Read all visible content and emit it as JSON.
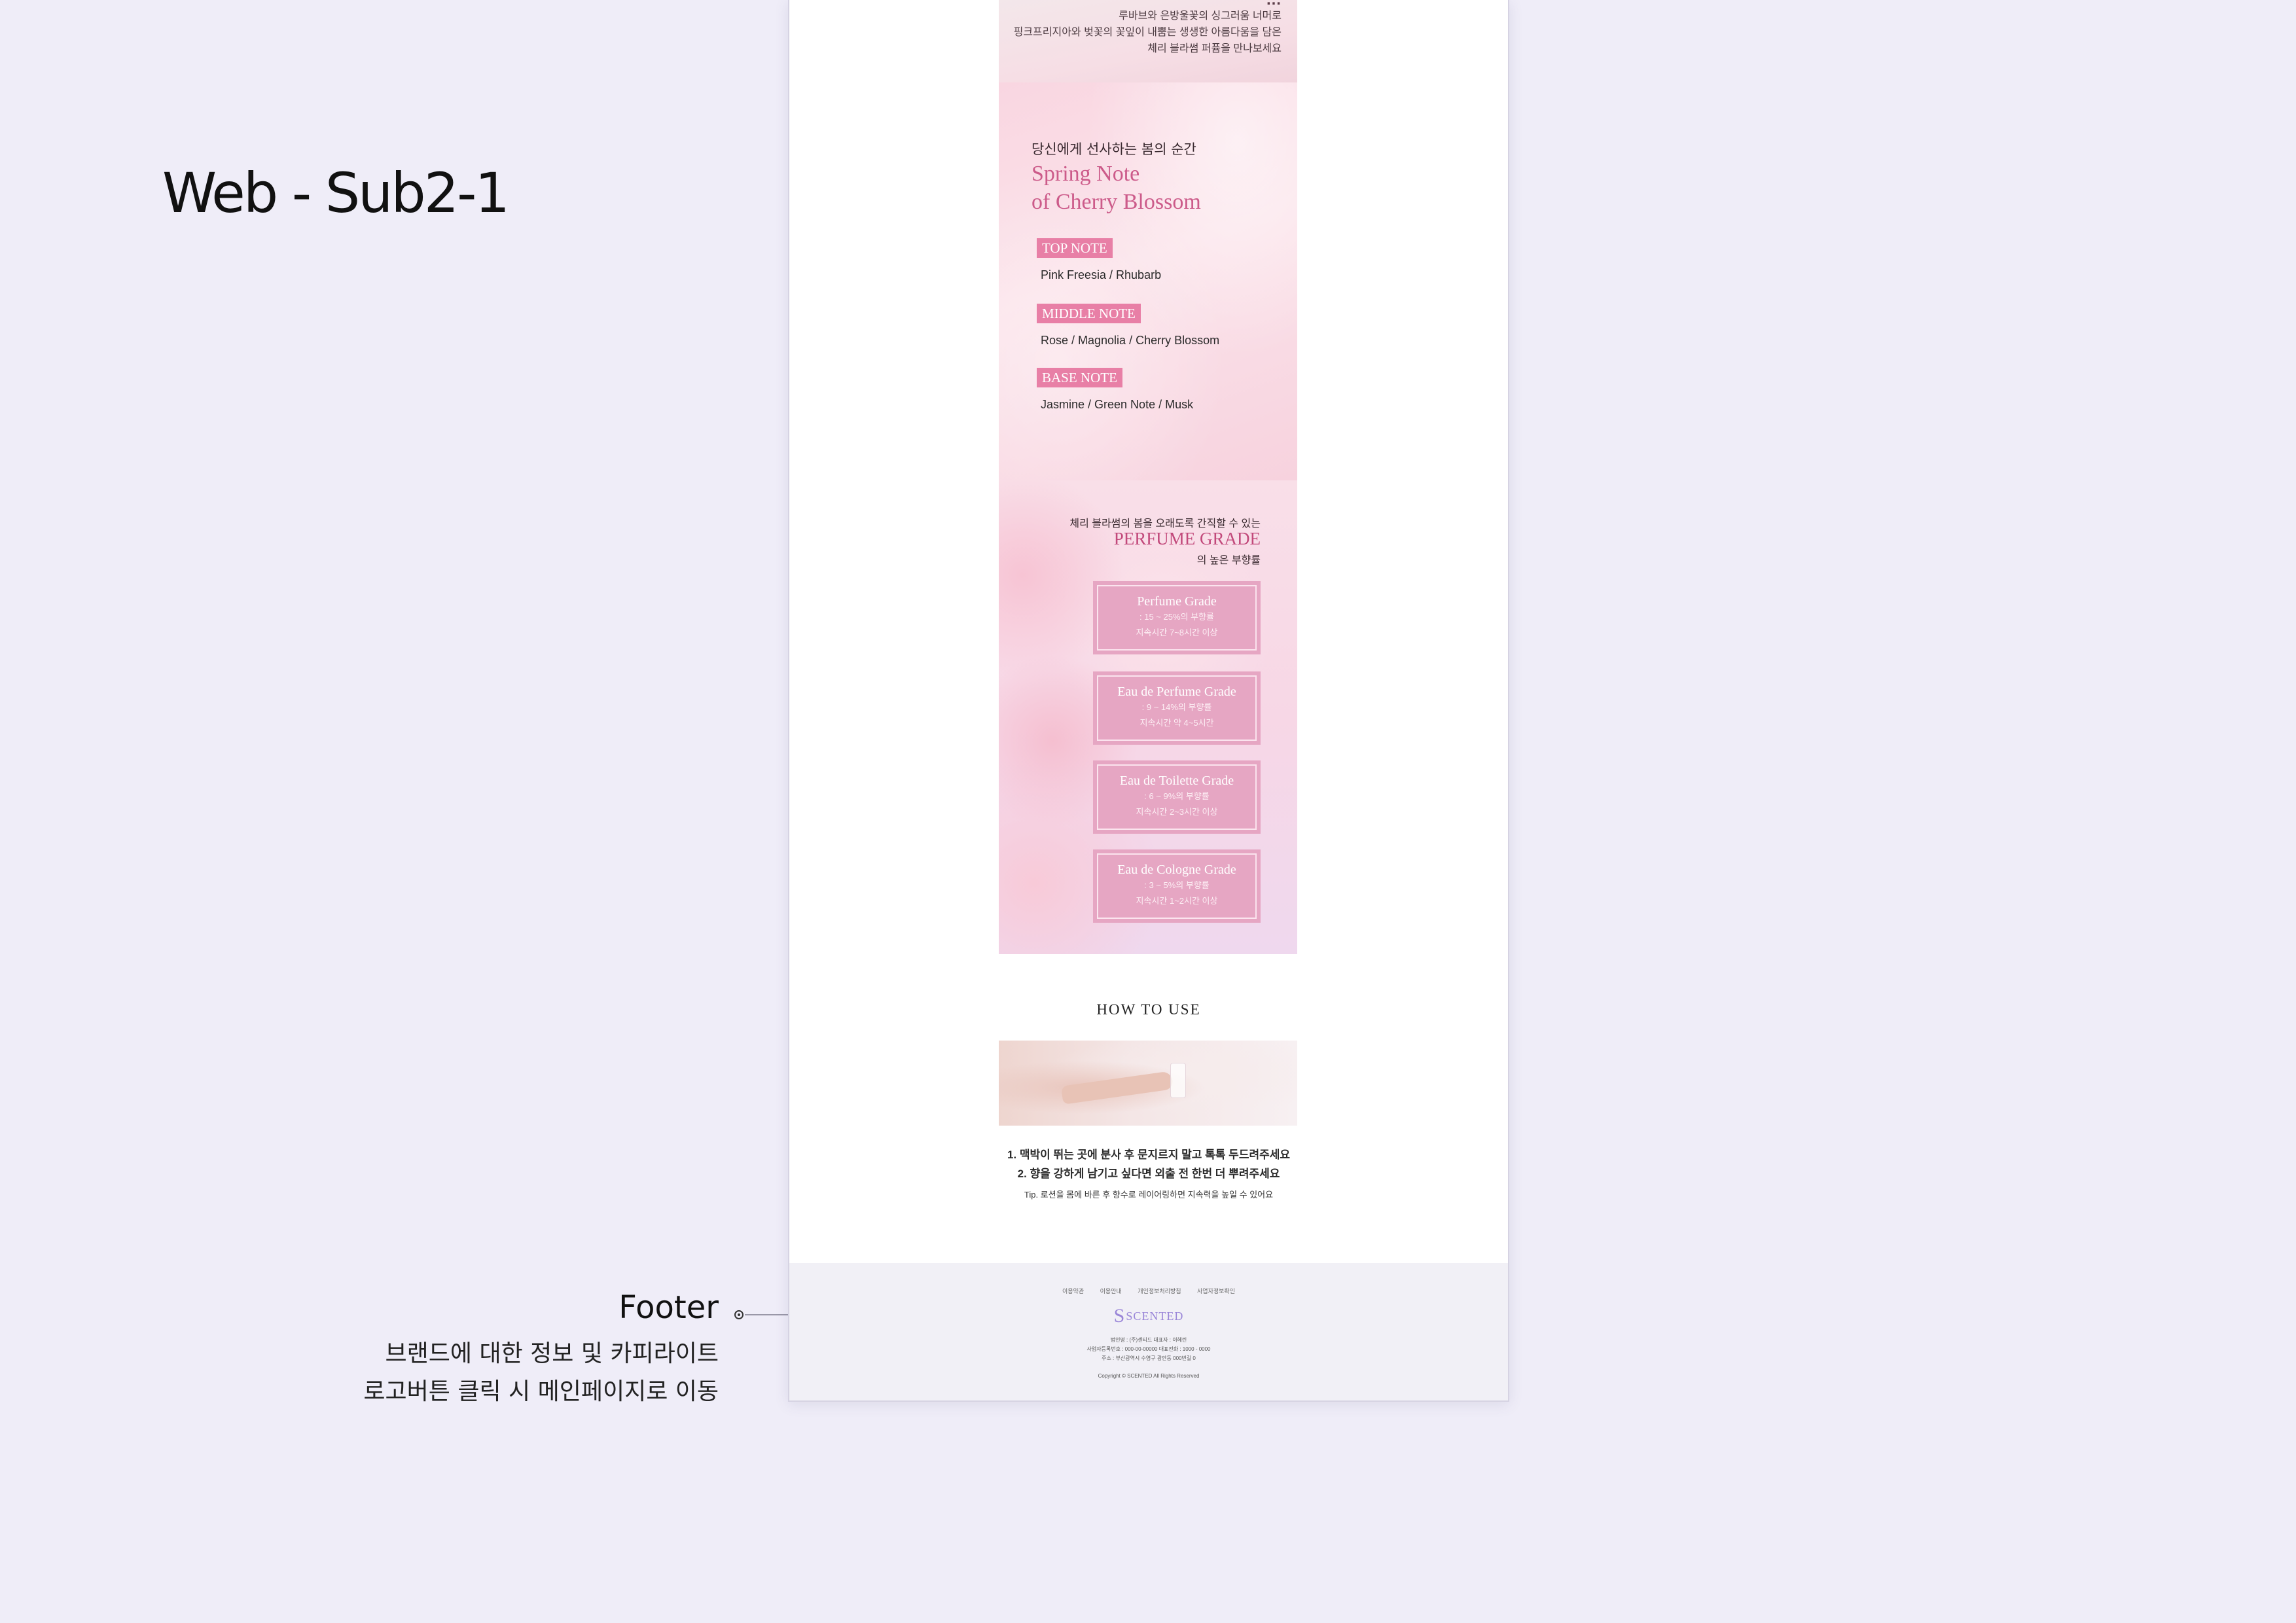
{
  "page_title": "Web - Sub2-1",
  "annotation": {
    "label": "Footer",
    "description": "브랜드에 대한 정보 및 카피라이트\n로고버튼 클릭 시 메인페이지로 이동"
  },
  "intro": {
    "cut_title": "…",
    "text": "루바브와 은방울꽃의 싱그러움 너머로\n핑크프리지아와 벚꽃의 꽃잎이 내뿜는 생생한 아름다움을 담은\n체리 블라썸 퍼퓸을 만나보세요"
  },
  "notes": {
    "kicker": "당신에게 선사하는 봄의 순간",
    "headline": "Spring Note\nof Cherry Blossom",
    "items": [
      {
        "tag": "TOP NOTE",
        "text": "Pink Freesia / Rhubarb"
      },
      {
        "tag": "MIDDLE NOTE",
        "text": "Rose / Magnolia / Cherry Blossom"
      },
      {
        "tag": "BASE NOTE",
        "text": "Jasmine / Green Note / Musk"
      }
    ]
  },
  "grade": {
    "kicker": "체리 블라썸의 봄을 오래도록 간직할 수 있는",
    "title": "PERFUME GRADE",
    "sub": "의 높은 부향률",
    "cards": [
      {
        "name": "Perfume Grade",
        "line1": ": 15 ~ 25%의 부향률",
        "line2": "지속시간 7~8시간 이상"
      },
      {
        "name": "Eau de Perfume Grade",
        "line1": ": 9 ~ 14%의 부향률",
        "line2": "지속시간 약 4~5시간"
      },
      {
        "name": "Eau de Toilette Grade",
        "line1": ": 6 ~ 9%의 부향률",
        "line2": "지속시간 2~3시간 이상"
      },
      {
        "name": "Eau de Cologne Grade",
        "line1": ": 3 ~ 5%의 부향률",
        "line2": "지속시간 1~2시간 이상"
      }
    ]
  },
  "howto": {
    "title": "HOW TO USE",
    "step1": "1. 맥박이 뛰는 곳에 분사 후 문지르지 말고 톡톡 두드려주세요",
    "step2": "2. 향을 강하게 남기고 싶다면 외출 전 한번 더 뿌려주세요",
    "tip": "Tip. 로션을 몸에 바른 후 향수로 레이어링하면 지속력을 높일 수 있어요"
  },
  "footer": {
    "links": [
      "이용약관",
      "이용안내",
      "개인정보처리방침",
      "사업자정보확인"
    ],
    "logo_mark": "S",
    "logo_text": "SCENTED",
    "info_line1": "법인명 : (주)센티드    대표자 : 이혜린",
    "info_line2": "사업자등록번호 : 000-00-00000    대표전화 : 1000 - 0000",
    "info_line3": "주소 : 부산광역시 수영구 광안동 000번길 0",
    "copyright": "Copyright © SCENTED All Rights Reserved"
  }
}
